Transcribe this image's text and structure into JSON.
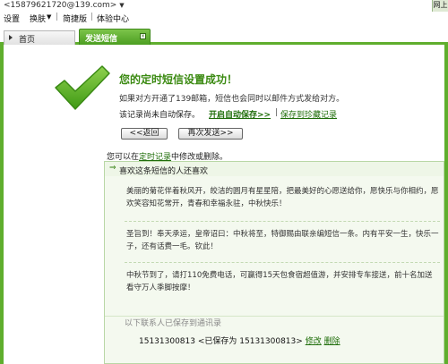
{
  "account": {
    "email": "<15879621720@139.com>",
    "arrow": "▼",
    "right_tag": "网上"
  },
  "menu": {
    "settings": "设置",
    "skin": "换肤",
    "skin_arrow": "▼",
    "sep1": "|",
    "simple": "简捷版",
    "sep2": "|",
    "experience": "体验中心"
  },
  "tabs": {
    "home": "首页",
    "send_sms": "发送短信",
    "close": "×"
  },
  "result": {
    "title": "您的定时短信设置成功！",
    "description": "如果对方开通了139邮箱，短信也会同时以邮件方式发给对方。",
    "unsaved": "该记录尚未自动保存。",
    "auto_save_link": "开启自动保存>>",
    "pipe": "|",
    "save_drafts_link": "保存到珍藏记录"
  },
  "buttons": {
    "back": "<<返回",
    "resend": "再次发送>>"
  },
  "hint": {
    "prefix": "您可以在",
    "link": "定时记录",
    "suffix": "中修改或删除。"
  },
  "panel": {
    "heading": "喜欢这条短信的人还喜欢",
    "messages": [
      "美丽的菊花伴着秋风开，皎洁的圆月有星星陪，把最美好的心愿送给你，愿快乐与你相约，愿欢笑容知花常开，青春和幸福永驻，中秋快乐！",
      "圣旨到！奉天承运，皇帝诏曰：中秋将至，特御赐由联亲编短信一条。内有平安一生，快乐一子，还有话费一毛。钦此！",
      "中秋节到了，请打110免费电话，可赢得15天包食宿超值游，并安排专车接送，前十名加送看守万人季脚按摩！"
    ]
  },
  "contacts": {
    "title": "以下联系人已保存到通讯录",
    "number": "15131300813",
    "saved_as": "<已保存为 15131300813>",
    "edit": "修改",
    "delete": "删除"
  }
}
